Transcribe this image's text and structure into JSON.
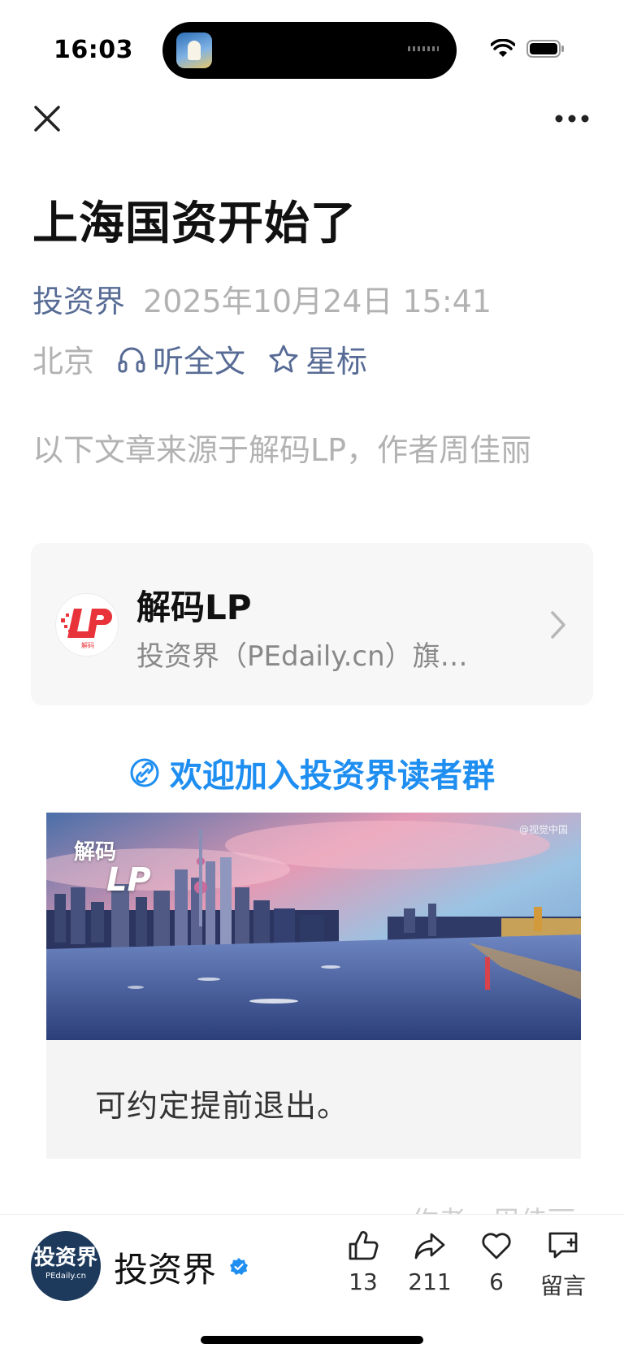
{
  "status_bar": {
    "time": "16:03"
  },
  "article": {
    "title": "上海国资开始了",
    "account": "投资界",
    "date": "2025年10月24日 15:41",
    "location": "北京",
    "listen_label": "听全文",
    "star_label": "星标",
    "source_note": "以下文章来源于解码LP，作者周佳丽"
  },
  "source_card": {
    "name": "解码LP",
    "description": "投资界（PEdaily.cn）旗…"
  },
  "join_link": "欢迎加入投资界读者群",
  "banner": {
    "brand_line1": "解码",
    "brand_line2": "LP",
    "credit": "@视觉中国"
  },
  "quote": "可约定提前退出。",
  "faded_text": "作者 · 周佳丽",
  "bottom_bar": {
    "account_name": "投资界",
    "avatar_text": "投资界",
    "avatar_subtext": "PEdaily.cn",
    "like_count": "13",
    "share_count": "211",
    "favorite_count": "6",
    "comment_label": "留言"
  },
  "colors": {
    "link": "#576b95",
    "accent": "#1f8ef1",
    "muted": "#b2b2b2"
  }
}
